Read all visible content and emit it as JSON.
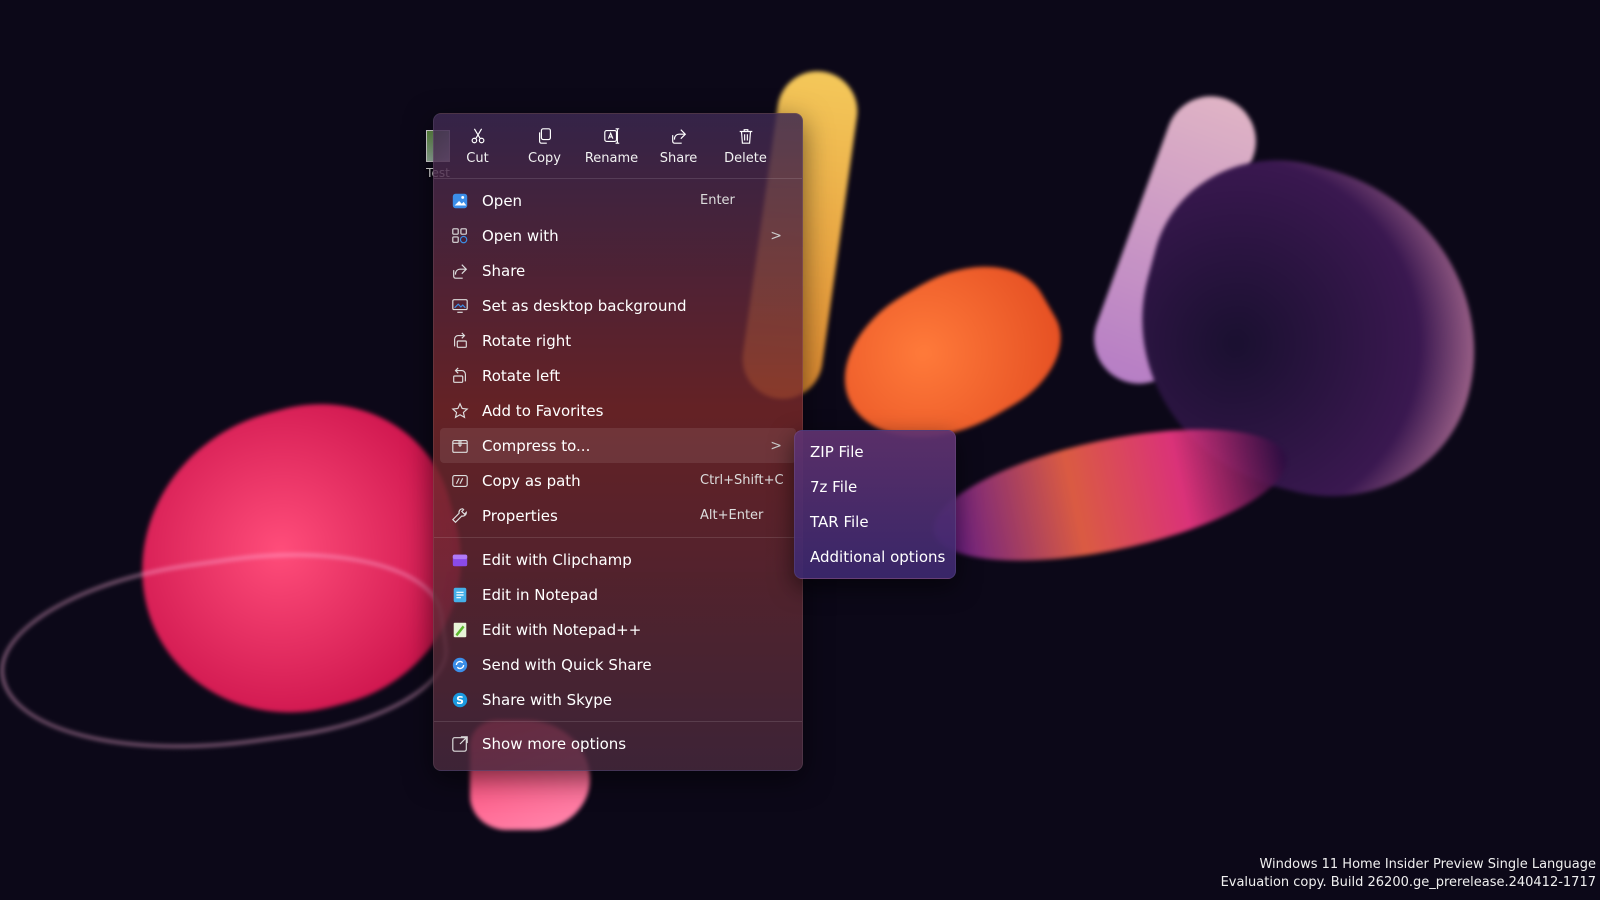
{
  "desktop": {
    "icon_label": "Test"
  },
  "toolbar": [
    {
      "label": "Cut",
      "icon": "scissors-icon"
    },
    {
      "label": "Copy",
      "icon": "copy-icon"
    },
    {
      "label": "Rename",
      "icon": "rename-icon"
    },
    {
      "label": "Share",
      "icon": "share-icon"
    },
    {
      "label": "Delete",
      "icon": "trash-icon"
    }
  ],
  "menu": {
    "items": [
      {
        "label": "Open",
        "shortcut": "Enter",
        "icon": "image-icon"
      },
      {
        "label": "Open with",
        "chevron": ">",
        "icon": "apps-icon"
      },
      {
        "label": "Share",
        "icon": "share-icon"
      },
      {
        "label": "Set as desktop background",
        "icon": "desktop-icon"
      },
      {
        "label": "Rotate right",
        "icon": "rotate-right-icon"
      },
      {
        "label": "Rotate left",
        "icon": "rotate-left-icon"
      },
      {
        "label": "Add to Favorites",
        "icon": "star-icon"
      },
      {
        "label": "Compress to...",
        "chevron": ">",
        "icon": "archive-icon"
      },
      {
        "label": "Copy as path",
        "shortcut": "Ctrl+Shift+C",
        "icon": "path-icon"
      },
      {
        "label": "Properties",
        "shortcut": "Alt+Enter",
        "icon": "wrench-icon"
      },
      {
        "label": "Edit with Clipchamp",
        "icon": "clipchamp-icon"
      },
      {
        "label": "Edit in Notepad",
        "icon": "notepad-icon"
      },
      {
        "label": "Edit with Notepad++",
        "icon": "notepadpp-icon"
      },
      {
        "label": "Send with Quick Share",
        "icon": "quick-share-icon"
      },
      {
        "label": "Share with Skype",
        "icon": "skype-icon"
      },
      {
        "label": "Show more options",
        "icon": "more-options-icon"
      }
    ]
  },
  "submenu": {
    "items": [
      "ZIP File",
      "7z File",
      "TAR File",
      "Additional options"
    ]
  },
  "watermark": {
    "line1": "Windows 11 Home Insider Preview Single Language",
    "line2": "Evaluation copy. Build 26200.ge_prerelease.240412-1717"
  },
  "colors": {
    "accent": "#3b8ee8",
    "menu_bg": "#3c2850"
  }
}
